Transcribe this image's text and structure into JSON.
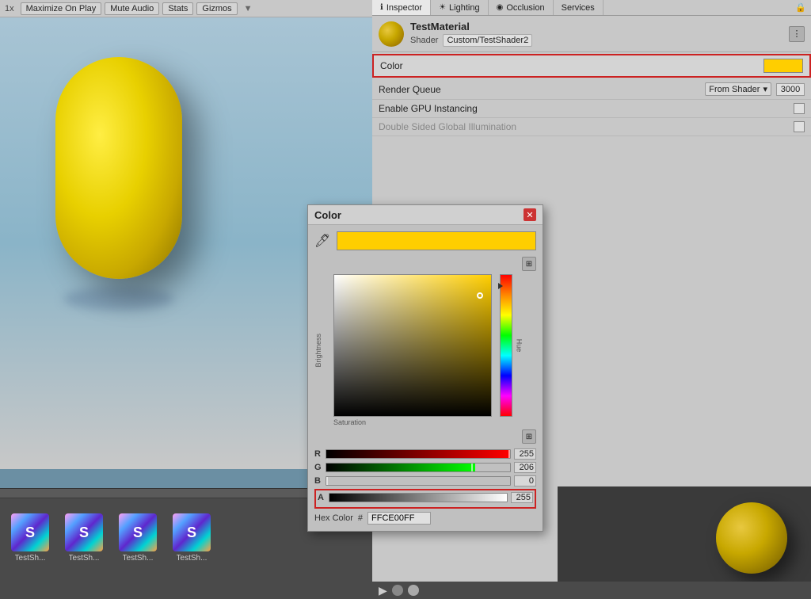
{
  "tabs": {
    "inspector": "Inspector",
    "lighting": "Lighting",
    "occlusion": "Occlusion",
    "services": "Services"
  },
  "viewport": {
    "zoom_label": "1x",
    "maximize_btn": "Maximize On Play",
    "mute_btn": "Mute Audio",
    "stats_btn": "Stats",
    "gizmos_btn": "Gizmos"
  },
  "material": {
    "name": "TestMaterial",
    "shader_label": "Shader",
    "shader_value": "Custom/TestShader2"
  },
  "properties": {
    "color_label": "Color",
    "render_queue_label": "Render Queue",
    "render_queue_dropdown": "From Shader",
    "render_queue_value": "3000",
    "gpu_instancing_label": "Enable GPU Instancing",
    "double_sided_label": "Double Sided Global Illumination"
  },
  "color_picker": {
    "title": "Color",
    "saturation_label": "Saturation",
    "brightness_label": "Brightness",
    "hue_label": "Hue",
    "r_label": "R",
    "r_value": "255",
    "g_label": "G",
    "g_value": "206",
    "b_label": "B",
    "b_value": "0",
    "a_label": "A",
    "a_value": "255",
    "hex_label": "Hex Color",
    "hex_hash": "#",
    "hex_value": "FFCE00FF"
  },
  "assets": [
    {
      "label": "TestSh...",
      "initial": "S"
    },
    {
      "label": "TestSh...",
      "initial": "S"
    },
    {
      "label": "TestSh...",
      "initial": "S"
    },
    {
      "label": "TestSh...",
      "initial": "S"
    }
  ]
}
